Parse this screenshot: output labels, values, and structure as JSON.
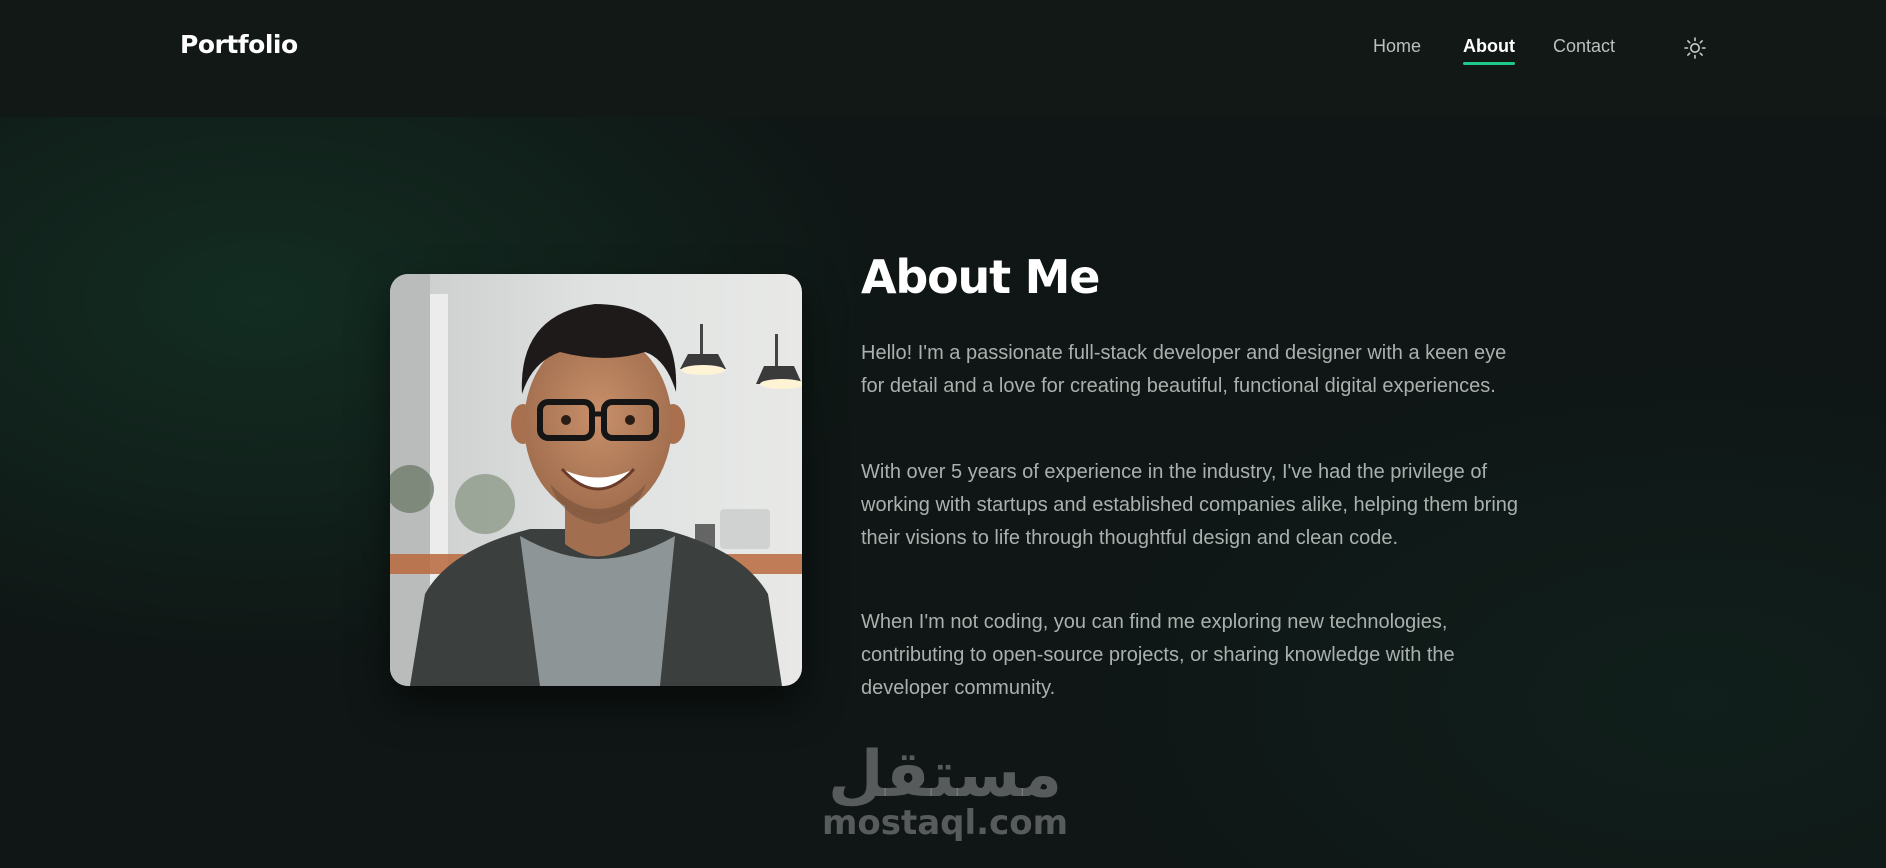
{
  "header": {
    "brand": "Portfolio",
    "nav": [
      {
        "label": "Home",
        "active": false
      },
      {
        "label": "About",
        "active": true
      },
      {
        "label": "Contact",
        "active": false
      }
    ],
    "theme_toggle_icon": "sun-icon",
    "accent_color": "#1fc98a"
  },
  "about": {
    "title": "About Me",
    "paragraphs": [
      "Hello! I'm a passionate full-stack developer and designer with a keen eye for detail and a love for creating beautiful, functional digital experiences.",
      "With over 5 years of experience in the industry, I've had the privilege of working with startups and established companies alike, helping them bring their visions to life through thoughtful design and clean code.",
      "When I'm not coding, you can find me exploring new technologies, contributing to open-source projects, or sharing knowledge with the developer community."
    ]
  },
  "watermark": {
    "arabic": "مستقل",
    "latin": "mostaql.com"
  }
}
